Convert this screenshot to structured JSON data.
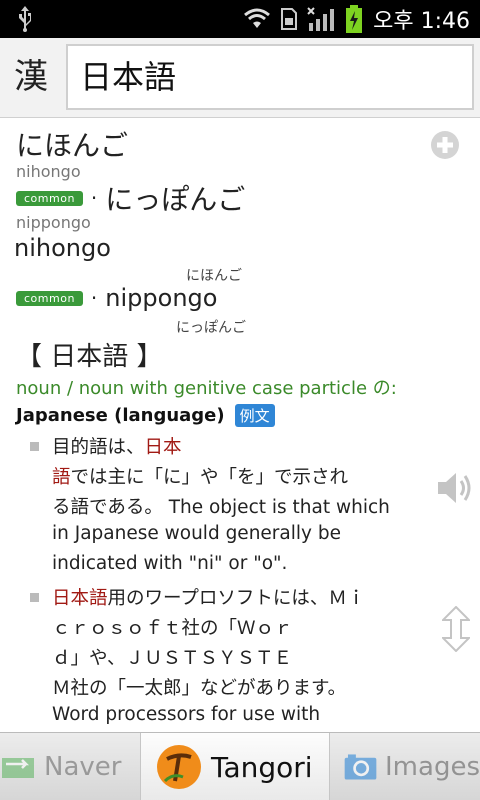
{
  "status_bar": {
    "time": "오후 1:46",
    "colors": {
      "battery": "#7ed321"
    }
  },
  "header": {
    "kanji_button_label": "漢",
    "search_value": "日本語"
  },
  "entry": {
    "reading_1": {
      "kana": "にほんご",
      "romaji": "nihongo"
    },
    "reading_2": {
      "badge": "common",
      "dot": "·",
      "kana": "にっぽんご",
      "romaji": "nippongo"
    },
    "romaji_reading_1": "nihongo",
    "romaji_reading_2": {
      "furigana_top": "にほんご",
      "badge": "common",
      "dot": "·",
      "romaji": "nippongo",
      "furigana_bottom": "にっぽんご"
    },
    "headword": "【 日本語 】",
    "pos": "noun / noun with genitive case particle の:",
    "gloss": "Japanese (language)",
    "example_badge": "例文",
    "example_1": {
      "l1_a": "目的語は、",
      "l1_b": "日本",
      "l2_a": "語",
      "l2_b": "では主に「に」や「を」で示され",
      "l3": "る語である。 The object is that which",
      "l4": "in Japanese would generally be",
      "l5": "indicated with \"ni\" or \"o\"."
    },
    "example_2": {
      "l1_a": "日本語",
      "l1_b": "用のワープロソフトには、Ｍｉ",
      "l2": "ｃｒｏｓｏｆｔ社の「Ｗｏｒ",
      "l3": "ｄ」や、ＪＵＳＴＳＹＳＴＥ",
      "l4": "Ｍ社の「一太郎」などがあります。",
      "l5": "Word processors for use with"
    }
  },
  "tabs": {
    "naver": "Naver",
    "tangori": "Tangori",
    "images": "Images"
  },
  "colors": {
    "pos_green": "#3b8a2a",
    "badge_green": "#3a9a3a",
    "highlight_red": "#a11a14",
    "example_blue": "#2f86d6"
  }
}
